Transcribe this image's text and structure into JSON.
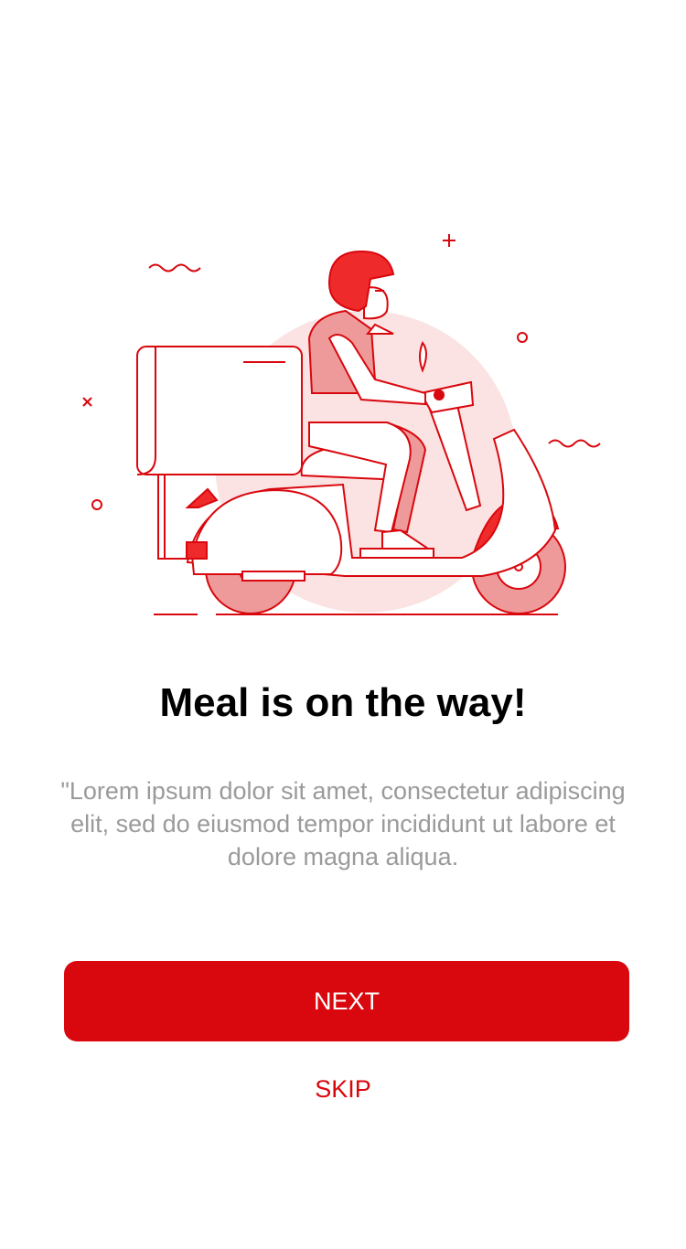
{
  "onboarding": {
    "title": "Meal is on the way!",
    "description": "\"Lorem ipsum dolor sit amet, consectetur adipiscing elit, sed do eiusmod tempor incididunt ut labore et dolore magna aliqua.",
    "next_label": "NEXT",
    "skip_label": "SKIP"
  },
  "illustration": {
    "icon": "delivery-scooter-icon"
  },
  "colors": {
    "accent": "#d9070e",
    "helmet": "#ef2a2a",
    "soft_pink": "#fbe3e3",
    "mid_pink": "#ee9a9a",
    "text_title": "#000000",
    "text_body": "#9a9a9a"
  }
}
